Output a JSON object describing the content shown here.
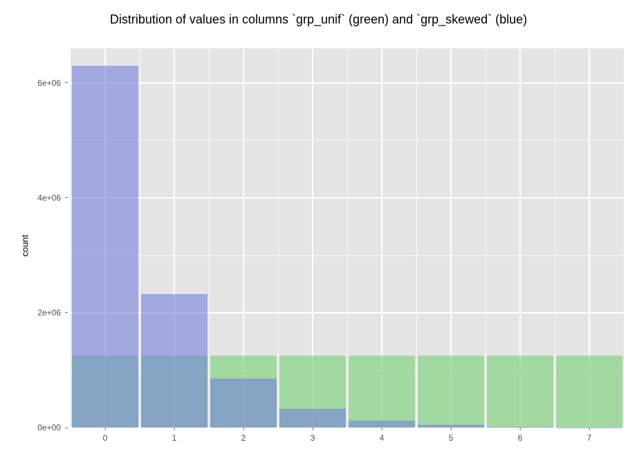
{
  "chart_data": {
    "type": "bar",
    "title": "Distribution of values in columns `grp_unif` (green) and `grp_skewed` (blue)",
    "ylabel": "count",
    "xlabel": "",
    "categories": [
      0,
      1,
      2,
      3,
      4,
      5,
      6,
      7
    ],
    "series": [
      {
        "name": "grp_unif",
        "color": "#8fd98f",
        "values": [
          1250000,
          1250000,
          1250000,
          1250000,
          1250000,
          1250000,
          1250000,
          1250000
        ]
      },
      {
        "name": "grp_skewed",
        "color": "#8a8ee6",
        "values": [
          6300000,
          2320000,
          860000,
          320000,
          120000,
          45000,
          15000,
          5000
        ]
      }
    ],
    "ylim": [
      0,
      6600000
    ],
    "yticks": [
      0,
      2000000,
      4000000,
      6000000
    ],
    "ytick_labels": [
      "0e+00",
      "2e+06",
      "4e+06",
      "6e+06"
    ],
    "xlim": [
      -0.5,
      7.5
    ],
    "grid": true
  }
}
